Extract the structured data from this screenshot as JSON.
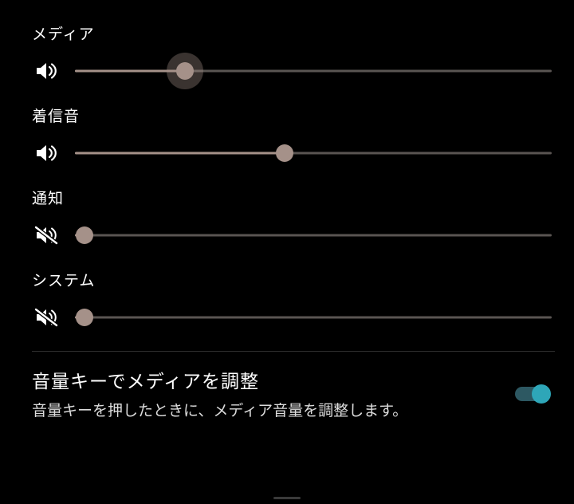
{
  "volumes": {
    "media": {
      "label": "メディア",
      "muted": false,
      "level": 23,
      "focused": true
    },
    "ringtone": {
      "label": "着信音",
      "muted": false,
      "level": 44,
      "focused": false
    },
    "notif": {
      "label": "通知",
      "muted": true,
      "level": 2,
      "focused": false
    },
    "system": {
      "label": "システム",
      "muted": true,
      "level": 2,
      "focused": false
    }
  },
  "setting": {
    "title": "音量キーでメディアを調整",
    "desc": "音量キーを押したときに、メディア音量を調整します。",
    "enabled": true
  },
  "colors": {
    "accent_teal": "#2ea6b8",
    "thumb": "#a59189",
    "track": "#5a5552"
  }
}
